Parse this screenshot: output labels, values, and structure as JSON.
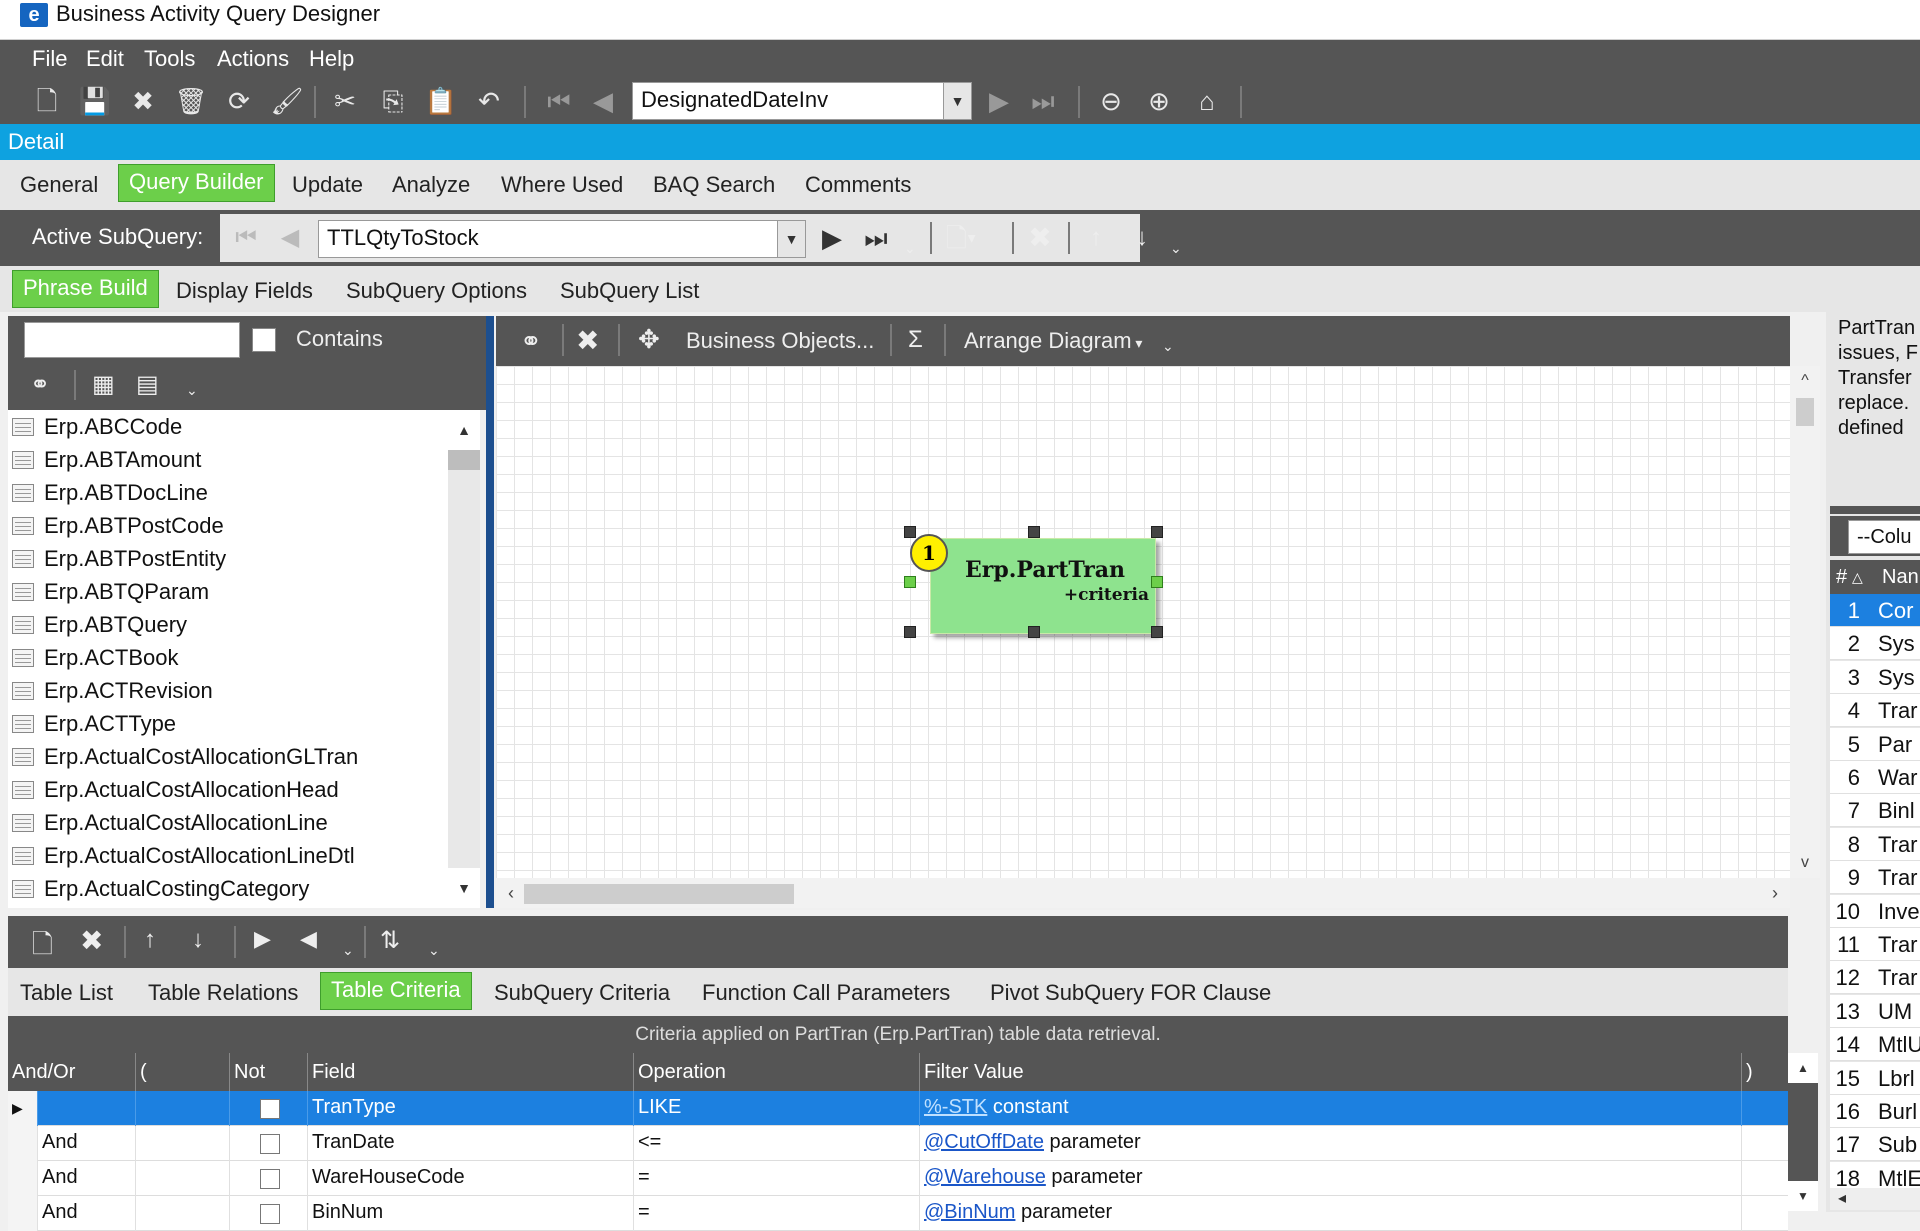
{
  "window": {
    "title": "Business Activity Query Designer"
  },
  "menu": [
    "File",
    "Edit",
    "Tools",
    "Actions",
    "Help"
  ],
  "toolbar": {
    "query_combo": "DesignatedDateInv"
  },
  "detail_label": "Detail",
  "main_tabs": [
    "General",
    "Query Builder",
    "Update",
    "Analyze",
    "Where Used",
    "BAQ Search",
    "Comments"
  ],
  "subquery": {
    "label": "Active SubQuery:",
    "value": "TTLQtyToStock"
  },
  "sub_tabs": [
    "Phrase Build",
    "Display Fields",
    "SubQuery Options",
    "SubQuery List"
  ],
  "search": {
    "value": "",
    "contains_label": "Contains"
  },
  "diagram_toolbar": {
    "business_objects": "Business Objects...",
    "sigma": "Σ",
    "arrange": "Arrange Diagram"
  },
  "tables": [
    "Erp.ABCCode",
    "Erp.ABTAmount",
    "Erp.ABTDocLine",
    "Erp.ABTPostCode",
    "Erp.ABTPostEntity",
    "Erp.ABTQParam",
    "Erp.ABTQuery",
    "Erp.ACTBook",
    "Erp.ACTRevision",
    "Erp.ACTType",
    "Erp.ActualCostAllocationGLTran",
    "Erp.ActualCostAllocationHead",
    "Erp.ActualCostAllocationLine",
    "Erp.ActualCostAllocationLineDtl",
    "Erp.ActualCostingCategory"
  ],
  "diagram_node": {
    "badge": "1",
    "title": "Erp.PartTran",
    "subtitle": "+criteria"
  },
  "right_panel": {
    "description_lines": [
      "PartTran",
      "issues, F",
      "Transfer",
      "replace.",
      "defined"
    ],
    "column_combo": "--Colu",
    "header": {
      "num": "#",
      "name": "Nan"
    },
    "rows": [
      {
        "n": "1",
        "name": "Cor"
      },
      {
        "n": "2",
        "name": "Sys"
      },
      {
        "n": "3",
        "name": "Sys"
      },
      {
        "n": "4",
        "name": "Trar"
      },
      {
        "n": "5",
        "name": "Par"
      },
      {
        "n": "6",
        "name": "War"
      },
      {
        "n": "7",
        "name": "Binl"
      },
      {
        "n": "8",
        "name": "Trar"
      },
      {
        "n": "9",
        "name": "Trar"
      },
      {
        "n": "10",
        "name": "Inve"
      },
      {
        "n": "11",
        "name": "Trar"
      },
      {
        "n": "12",
        "name": "Trar"
      },
      {
        "n": "13",
        "name": "UM"
      },
      {
        "n": "14",
        "name": "MtlU"
      },
      {
        "n": "15",
        "name": "Lbrl"
      },
      {
        "n": "16",
        "name": "Burl"
      },
      {
        "n": "17",
        "name": "Sub"
      },
      {
        "n": "18",
        "name": "MtlE"
      }
    ]
  },
  "bottom_tabs": [
    "Table List",
    "Table Relations",
    "Table Criteria",
    "SubQuery Criteria",
    "Function Call Parameters",
    "Pivot SubQuery FOR Clause"
  ],
  "criteria_caption": "Criteria applied on PartTran (Erp.PartTran) table data retrieval.",
  "criteria_headers": [
    "And/Or",
    "(",
    "Not",
    "Field",
    "Operation",
    "Filter Value",
    ")"
  ],
  "criteria_rows": [
    {
      "andor": "",
      "field": "TranType",
      "op": "LIKE",
      "value_link": "%-STK",
      "value_type": "constant"
    },
    {
      "andor": "And",
      "field": "TranDate",
      "op": "<=",
      "value_link": "@CutOffDate",
      "value_type": "parameter"
    },
    {
      "andor": "And",
      "field": "WareHouseCode",
      "op": "=",
      "value_link": "@Warehouse",
      "value_type": "parameter"
    },
    {
      "andor": "And",
      "field": "BinNum",
      "op": "=",
      "value_link": "@BinNum",
      "value_type": "parameter"
    }
  ]
}
